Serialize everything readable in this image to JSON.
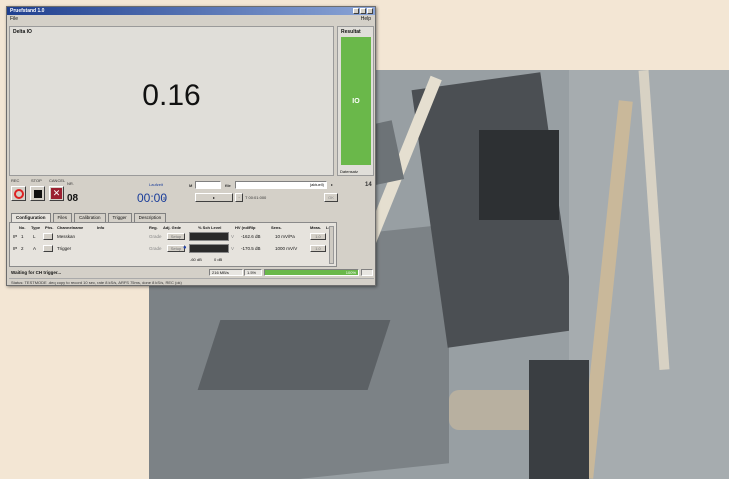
{
  "app": {
    "title": "Pruefstand 1.0",
    "menu": {
      "file": "File",
      "help": "Help"
    }
  },
  "display": {
    "title": "Delta IO",
    "value": "0.16"
  },
  "result": {
    "title": "Resultat",
    "status": "IO",
    "status_color": "#6ab84a",
    "footer": "Datensatz"
  },
  "transport": {
    "rec_label": "REC",
    "stop_label": "STOP",
    "cancel_label": "CANCEL",
    "count_label": "NR.",
    "count": "08",
    "timer_label": "Laufzeit",
    "timer": "00:00",
    "timer_unit": "s",
    "file_label": "file",
    "file_right": "(aktuell)",
    "time_readout": "T 00:01:000",
    "ok_label": "OK"
  },
  "tabs": [
    {
      "label": "Configuration",
      "active": true
    },
    {
      "label": "Files",
      "active": false
    },
    {
      "label": "Calibration",
      "active": false
    },
    {
      "label": "Trigger",
      "active": false
    },
    {
      "label": "Description",
      "active": false
    }
  ],
  "config_table": {
    "headers": [
      "No.",
      "Type",
      "Phs.",
      "Channelname",
      "Info",
      "Reg.",
      "Adj. Grde",
      "% Sch Level",
      "HV (nd/Rlp",
      "Sens.",
      "Meas.",
      "Lev."
    ],
    "rows": [
      {
        "flag": "IP",
        "no": "1",
        "type": "L",
        "name": "Messkan",
        "reg": "Grade",
        "adj": "Setup",
        "level": "-162.6 dB",
        "sens": "10 mV/Pa",
        "meas": "1.0"
      },
      {
        "flag": "IP",
        "no": "2",
        "type": "A",
        "name": "Trigger",
        "reg": "Grade",
        "adj": "Setup",
        "level": "-170.5 dB",
        "sens": "1000 mV/V",
        "meas": "1.0"
      }
    ],
    "scale_left": "-60 dB",
    "scale_right": "0 dB"
  },
  "status_bar": {
    "message": "Waiting for CH trigger...",
    "memory": "216 MB/s",
    "percent": "1.5%",
    "progress_label": "100%",
    "progress_value": 1.0,
    "footer": "Status: TESTMODE .deq  copy to record 10 sec, rate 8 kS/s, ARFS 75ms, done 8 kS/s, REC  (ok)"
  }
}
